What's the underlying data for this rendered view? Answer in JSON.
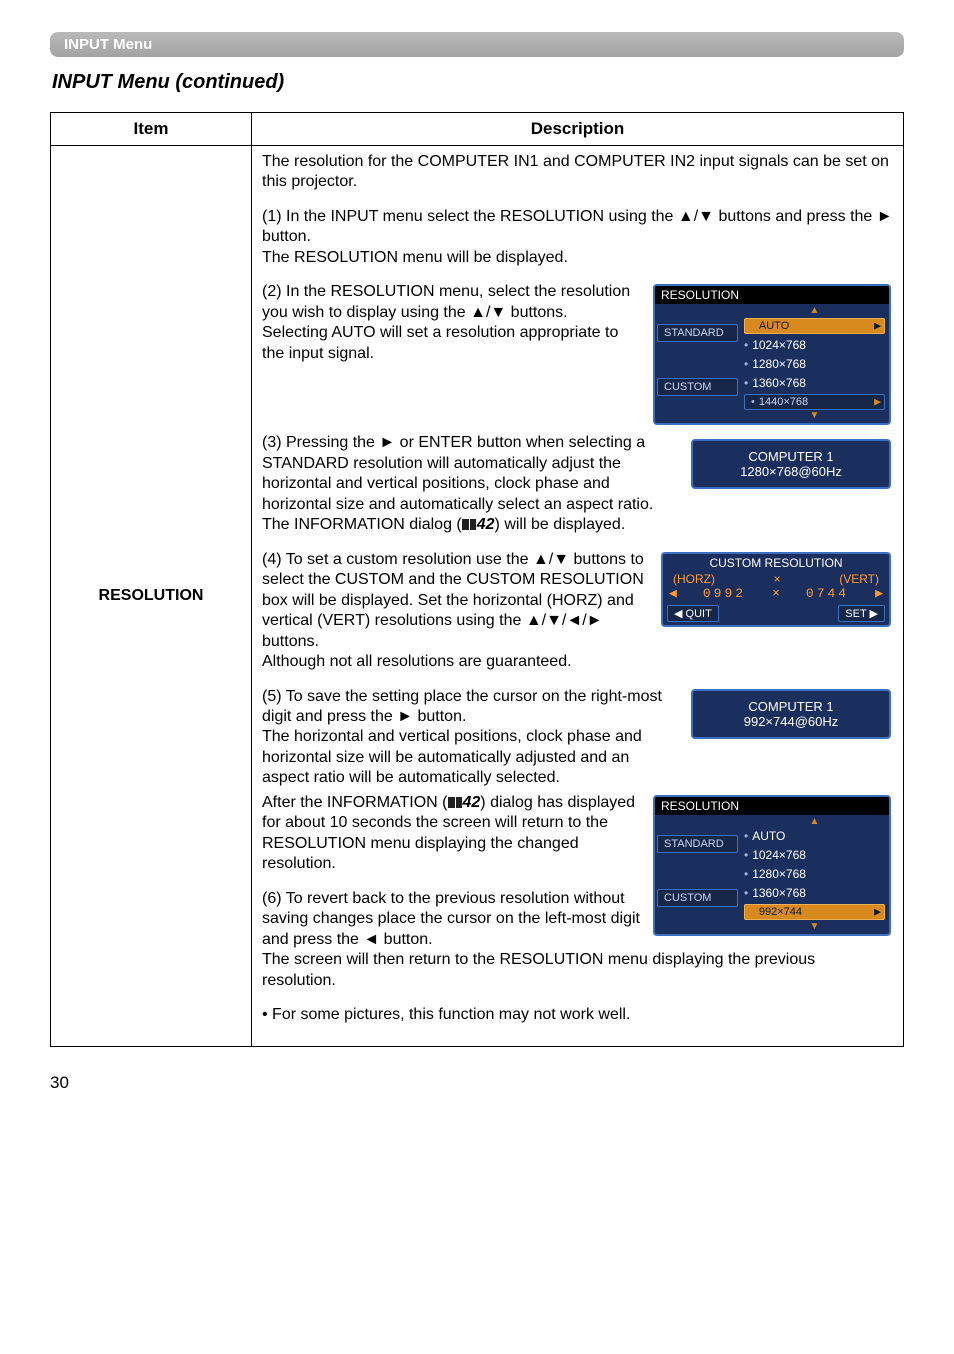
{
  "tab_header": "INPUT Menu",
  "page_title": "INPUT Menu (continued)",
  "table": {
    "headers": {
      "item": "Item",
      "description": "Description"
    },
    "item_label": "RESOLUTION",
    "intro": "The resolution for the COMPUTER IN1 and COMPUTER IN2 input signals can be set on this projector.",
    "step1a": "(1) In the INPUT menu select the RESOLUTION using the ▲/▼ buttons and press the ► button.",
    "step1b": "The RESOLUTION menu will be displayed.",
    "step2a": "(2)  In the RESOLUTION menu, select the resolution you wish to display using the ▲/▼ buttons.",
    "step2b": "Selecting AUTO will set a resolution appropriate to the input signal.",
    "step3a": "(3) Pressing the ► or ENTER button when selecting a STANDARD resolution will automatically adjust the horizontal and vertical positions, clock phase and horizontal size and automatically select an aspect ratio.",
    "step3b_prefix": "The INFORMATION dialog (",
    "step3b_ref": "42",
    "step3b_suffix": ") will be displayed.",
    "step4a": "(4) To set a custom resolution use the ▲/▼ buttons to select the CUSTOM and the CUSTOM RESOLUTION box will be displayed. Set the horizontal (HORZ) and vertical (VERT) resolutions using the ▲/▼/◄/► buttons.",
    "step4b": "Although not all resolutions are guaranteed.",
    "step5a": "(5) To save the setting place the cursor on the right-most digit and press the ► button.",
    "step5b": "The horizontal and vertical positions, clock phase and horizontal size will be automatically adjusted and an aspect ratio will be automatically selected.",
    "step5c_prefix": "After the INFORMATION (",
    "step5c_ref": "42",
    "step5c_suffix": ") dialog has displayed for about 10 seconds the screen will return to the RESOLUTION menu displaying the changed resolution.",
    "step6a": "(6) To revert back to the previous resolution without saving changes place the cursor on the left-most digit and press the ◄ button.",
    "step6b": "The screen will then return to the RESOLUTION menu displaying the previous resolution.",
    "note": "• For some pictures, this function may not work well."
  },
  "osd": {
    "res_menu_title": "RESOLUTION",
    "standard": "STANDARD",
    "custom": "CUSTOM",
    "auto": "AUTO",
    "r1024": "1024×768",
    "r1280": "1280×768",
    "r1360": "1360×768",
    "r1440": "1440×768",
    "info1_l1": "COMPUTER 1",
    "info1_l2": "1280×768@60Hz",
    "custom_title": "CUSTOM RESOLUTION",
    "horz": "(HORZ)",
    "vert": "(VERT)",
    "x": "×",
    "hv": "0992",
    "vv": "0744",
    "quit": "QUIT",
    "set": "SET",
    "info2_l1": "COMPUTER 1",
    "info2_l2": "992×744@60Hz",
    "r992": "992×744"
  },
  "page_number": "30"
}
